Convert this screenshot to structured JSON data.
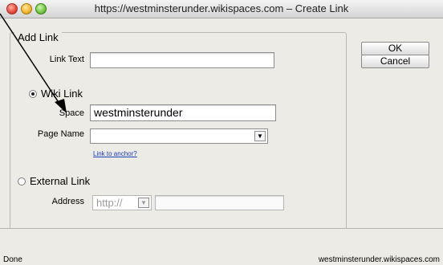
{
  "window": {
    "title": "https://westminsterunder.wikispaces.com – Create Link"
  },
  "dialog": {
    "group_legend": "Add Link",
    "link_text_label": "Link Text",
    "link_text_value": "",
    "wiki_link_label": "Wiki Link",
    "space_label": "Space",
    "space_value": "westminsterunder",
    "page_name_label": "Page Name",
    "page_name_value": "",
    "link_to_anchor": "Link to anchor?",
    "external_link_label": "External Link",
    "address_label": "Address",
    "address_protocol": "http://",
    "address_value": "",
    "ok_label": "OK",
    "cancel_label": "Cancel",
    "selected_option": "Wiki Link"
  },
  "status": {
    "left": "Done",
    "right": "westminsterunder.wikispaces.com"
  },
  "colors": {
    "background": "#ecebe6",
    "link": "#1a3fb7"
  }
}
